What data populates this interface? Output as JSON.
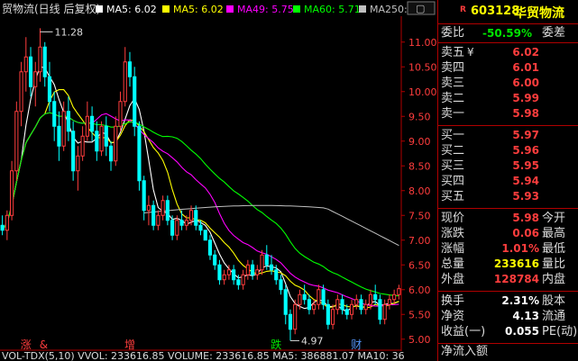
{
  "chart": {
    "header": {
      "title": "贸物流(日线 后复权)",
      "ma5": "MA5: 6.02",
      "ma10": "MA5: 6.02",
      "ma49": "MA49: 5.75",
      "ma60": "MA60: 5.71",
      "ma250": "MA250: 6"
    },
    "price_axis": [
      "11.00",
      "10.50",
      "10.00",
      "9.50",
      "9.00",
      "8.50",
      "8.00",
      "7.50",
      "7.00",
      "6.50",
      "6.00",
      "5.50",
      "5.00"
    ],
    "high_label": "11.28",
    "low_label": "4.97",
    "events": [
      {
        "text": "涨",
        "color": "#ff3d3d"
      },
      {
        "text": "&",
        "color": "#ff3d3d"
      },
      {
        "text": "增",
        "color": "#ff3d3d"
      },
      {
        "text": "跌",
        "color": "#00e600"
      },
      {
        "text": "财",
        "color": "#5599ff"
      }
    ],
    "footer": "VOL-TDX(5,10) VVOL: 233616.85 VOLUME: 233616.85 MA5: 386881.07 MA10: 36",
    "colors": {
      "up": "#ff3d3d",
      "down": "#00ffff",
      "ma5": "#ffffff",
      "ma10": "#ffff00",
      "ma20": "#ff00ff",
      "ma60": "#00ff00",
      "ma250": "#c0c0c0"
    }
  },
  "chart_data": {
    "type": "candlestick",
    "ylim": [
      4.85,
      11.45
    ],
    "ohlc": [
      [
        7.3,
        7.5,
        7.1,
        7.2
      ],
      [
        7.2,
        7.6,
        7.0,
        7.5
      ],
      [
        7.5,
        8.6,
        7.4,
        8.4
      ],
      [
        8.4,
        9.8,
        8.2,
        9.6
      ],
      [
        9.6,
        10.6,
        9.3,
        10.4
      ],
      [
        10.4,
        11.1,
        10.0,
        10.7
      ],
      [
        10.7,
        10.9,
        9.9,
        10.1
      ],
      [
        10.1,
        10.6,
        9.7,
        10.4
      ],
      [
        10.4,
        11.28,
        10.2,
        10.9
      ],
      [
        10.9,
        11.0,
        10.1,
        10.3
      ],
      [
        10.3,
        10.6,
        9.6,
        9.8
      ],
      [
        9.8,
        10.0,
        9.0,
        9.3
      ],
      [
        9.3,
        9.6,
        8.6,
        8.9
      ],
      [
        8.9,
        9.8,
        8.8,
        9.6
      ],
      [
        9.6,
        9.9,
        9.0,
        9.2
      ],
      [
        9.2,
        9.4,
        8.2,
        8.4
      ],
      [
        8.4,
        8.9,
        8.0,
        8.7
      ],
      [
        8.7,
        9.3,
        8.6,
        9.1
      ],
      [
        9.1,
        9.8,
        9.0,
        9.5
      ],
      [
        9.5,
        9.7,
        9.0,
        9.2
      ],
      [
        9.2,
        9.4,
        8.6,
        8.8
      ],
      [
        8.8,
        9.4,
        8.7,
        9.3
      ],
      [
        9.3,
        9.5,
        8.7,
        8.9
      ],
      [
        8.9,
        9.0,
        8.4,
        8.6
      ],
      [
        8.6,
        9.5,
        8.5,
        9.3
      ],
      [
        9.3,
        10.0,
        9.2,
        9.8
      ],
      [
        9.8,
        10.9,
        9.7,
        10.6
      ],
      [
        10.6,
        10.8,
        10.1,
        10.3
      ],
      [
        10.3,
        10.5,
        9.1,
        9.3
      ],
      [
        9.3,
        9.4,
        8.0,
        8.2
      ],
      [
        8.2,
        8.3,
        7.4,
        7.6
      ],
      [
        7.6,
        7.9,
        7.3,
        7.7
      ],
      [
        7.7,
        7.8,
        7.2,
        7.3
      ],
      [
        7.3,
        7.6,
        7.2,
        7.5
      ],
      [
        7.5,
        7.9,
        7.4,
        7.8
      ],
      [
        7.8,
        7.9,
        7.3,
        7.4
      ],
      [
        7.4,
        7.5,
        7.0,
        7.1
      ],
      [
        7.1,
        7.5,
        7.0,
        7.4
      ],
      [
        7.4,
        7.6,
        7.2,
        7.3
      ],
      [
        7.3,
        7.5,
        7.2,
        7.4
      ],
      [
        7.4,
        7.7,
        7.3,
        7.6
      ],
      [
        7.6,
        7.7,
        7.2,
        7.3
      ],
      [
        7.3,
        7.4,
        7.1,
        7.2
      ],
      [
        7.2,
        6.9,
        6.9,
        7.0
      ],
      [
        7.0,
        7.1,
        6.6,
        6.7
      ],
      [
        6.7,
        6.8,
        6.4,
        6.5
      ],
      [
        6.5,
        6.6,
        6.1,
        6.2
      ],
      [
        6.2,
        6.4,
        6.1,
        6.3
      ],
      [
        6.3,
        6.5,
        6.2,
        6.4
      ],
      [
        6.4,
        6.5,
        6.1,
        6.2
      ],
      [
        6.2,
        6.3,
        6.0,
        6.1
      ],
      [
        6.1,
        6.4,
        6.0,
        6.3
      ],
      [
        6.3,
        6.6,
        6.2,
        6.5
      ],
      [
        6.5,
        6.6,
        6.2,
        6.3
      ],
      [
        6.3,
        6.5,
        6.2,
        6.4
      ],
      [
        6.4,
        6.8,
        6.3,
        6.7
      ],
      [
        6.7,
        6.9,
        6.4,
        6.5
      ],
      [
        6.5,
        6.7,
        6.3,
        6.4
      ],
      [
        6.4,
        6.5,
        6.1,
        6.2
      ],
      [
        6.2,
        6.3,
        5.9,
        6.0
      ],
      [
        6.0,
        6.1,
        5.3,
        5.5
      ],
      [
        5.5,
        5.6,
        4.97,
        5.2
      ],
      [
        5.2,
        5.8,
        5.1,
        5.7
      ],
      [
        5.7,
        6.0,
        5.6,
        5.9
      ],
      [
        5.9,
        6.1,
        5.7,
        5.8
      ],
      [
        5.8,
        5.9,
        5.5,
        5.6
      ],
      [
        5.6,
        5.8,
        5.5,
        5.7
      ],
      [
        5.7,
        6.1,
        5.6,
        6.0
      ],
      [
        6.0,
        6.1,
        5.6,
        5.7
      ],
      [
        5.7,
        5.8,
        5.2,
        5.3
      ],
      [
        5.3,
        5.7,
        5.2,
        5.6
      ],
      [
        5.6,
        5.9,
        5.5,
        5.8
      ],
      [
        5.8,
        5.9,
        5.5,
        5.6
      ],
      [
        5.6,
        5.7,
        5.4,
        5.5
      ],
      [
        5.5,
        5.8,
        5.4,
        5.7
      ],
      [
        5.7,
        5.9,
        5.6,
        5.8
      ],
      [
        5.8,
        5.9,
        5.5,
        5.6
      ],
      [
        5.6,
        5.8,
        5.5,
        5.7
      ],
      [
        5.7,
        6.0,
        5.6,
        5.9
      ],
      [
        5.9,
        6.1,
        5.7,
        5.8
      ],
      [
        5.8,
        5.9,
        5.3,
        5.4
      ],
      [
        5.4,
        5.8,
        5.3,
        5.7
      ],
      [
        5.7,
        5.9,
        5.6,
        5.8
      ],
      [
        5.8,
        6.0,
        5.7,
        5.9
      ],
      [
        5.9,
        6.1,
        5.8,
        6.02
      ]
    ]
  },
  "panel": {
    "code": "603128",
    "name": "华贸物流",
    "ratio_label": "委比",
    "ratio_value": "-50.59%",
    "diff_label": "委差",
    "asks": [
      {
        "label": "卖五",
        "mark": "¥",
        "value": "6.02"
      },
      {
        "label": "卖四",
        "mark": "",
        "value": "6.01"
      },
      {
        "label": "卖三",
        "mark": "",
        "value": "6.00"
      },
      {
        "label": "卖二",
        "mark": "",
        "value": "5.99"
      },
      {
        "label": "卖一",
        "mark": "",
        "value": "5.98"
      }
    ],
    "bids": [
      {
        "label": "买一",
        "value": "5.97"
      },
      {
        "label": "买二",
        "value": "5.96"
      },
      {
        "label": "买三",
        "value": "5.95"
      },
      {
        "label": "买四",
        "value": "5.94"
      },
      {
        "label": "买五",
        "value": "5.93"
      }
    ],
    "quote": [
      {
        "label": "现价",
        "value": "5.98",
        "color": "red",
        "label2": "今开"
      },
      {
        "label": "涨跌",
        "value": "0.06",
        "color": "red",
        "label2": "最高"
      },
      {
        "label": "涨幅",
        "value": "1.01%",
        "color": "red",
        "label2": "最低"
      },
      {
        "label": "总量",
        "value": "233616",
        "color": "yellow",
        "label2": "量比"
      },
      {
        "label": "外盘",
        "value": "128784",
        "color": "red",
        "label2": "内盘"
      }
    ],
    "fund": [
      {
        "label": "换手",
        "value": "2.31%",
        "color": "white",
        "label2": "股本"
      },
      {
        "label": "净资",
        "value": "4.13",
        "color": "white",
        "label2": "流通"
      },
      {
        "label": "收益(一)",
        "value": "0.055",
        "color": "white",
        "label2": "PE(动)"
      }
    ],
    "flow_label": "净流入额"
  }
}
